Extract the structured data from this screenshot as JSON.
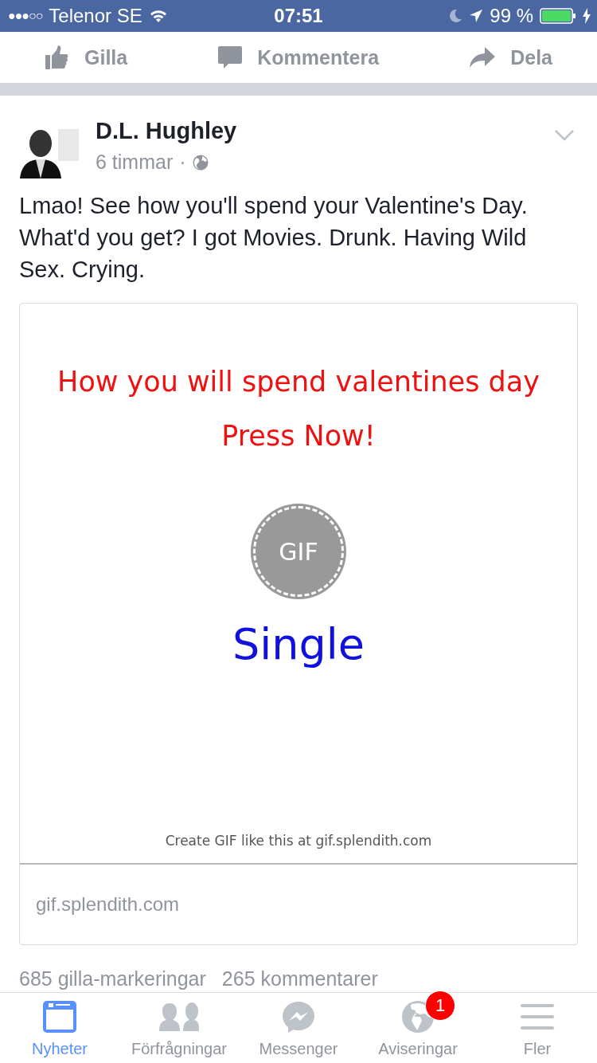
{
  "status_bar": {
    "signal_dots": "●●●○○",
    "carrier": "Telenor SE",
    "time": "07:51",
    "battery": "99 %"
  },
  "actions": [
    {
      "kind": "like",
      "label": "Gilla"
    },
    {
      "kind": "comment",
      "label": "Kommentera"
    },
    {
      "kind": "share",
      "label": "Dela"
    }
  ],
  "post": {
    "author": "D.L. Hughley",
    "time": "6 timmar",
    "separator": "·",
    "text": "Lmao! See how you'll spend your Valentine's Day. What'd you get? I got Movies. Drunk. Having Wild Sex. Crying.",
    "attachment": {
      "headline": "How you will spend valentines day",
      "cta": "Press Now!",
      "gif_label": "GIF",
      "result": "Single",
      "footer": "Create GIF like this at gif.splendith.com",
      "domain": "gif.splendith.com"
    },
    "likes": "685 gilla-markeringar",
    "comments": "265 kommentarer"
  },
  "tabs": [
    {
      "kind": "news",
      "label": "Nyheter",
      "selected": true
    },
    {
      "kind": "requests",
      "label": "Förfrågningar",
      "selected": false
    },
    {
      "kind": "messenger",
      "label": "Messenger",
      "selected": false
    },
    {
      "kind": "notifications",
      "label": "Aviseringar",
      "selected": false,
      "badge": "1"
    },
    {
      "kind": "more",
      "label": "Fler",
      "selected": false
    }
  ]
}
